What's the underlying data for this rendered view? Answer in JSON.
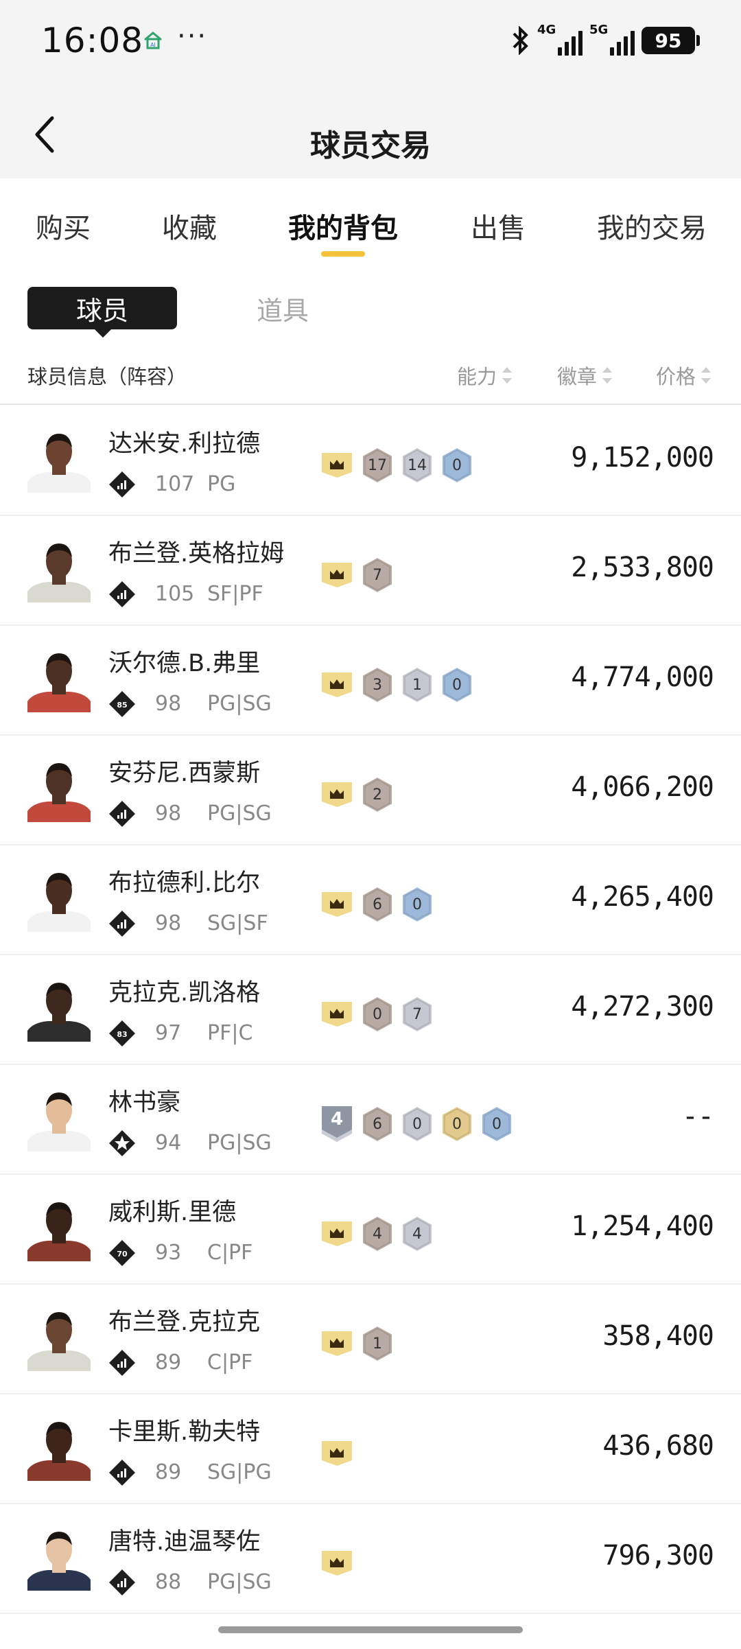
{
  "status_bar": {
    "time": "16:08",
    "dots": "···",
    "net_4g": "4G",
    "net_5g": "5G",
    "battery": "95"
  },
  "header": {
    "title": "球员交易",
    "back_icon": "chevron-left-icon"
  },
  "tabs": [
    {
      "label": "购买"
    },
    {
      "label": "收藏"
    },
    {
      "label": "我的背包",
      "active": true
    },
    {
      "label": "出售"
    },
    {
      "label": "我的交易"
    }
  ],
  "subtabs": {
    "active": "球员",
    "other": "道具"
  },
  "list_header": {
    "info": "球员信息（阵容）",
    "ability": "能力",
    "badge": "徽章",
    "price": "价格"
  },
  "colors": {
    "accent": "#f5c23b",
    "crown": "#f0d98a",
    "bronze": "#b7aba3",
    "silver": "#c6c7d0",
    "gold": "#e2c98c",
    "blue": "#9db9da"
  },
  "players": [
    {
      "name": "达米安.利拉德",
      "rating": "107",
      "position": "PG",
      "rank_icon": "signal-rank-icon",
      "rank_text": "",
      "crown": true,
      "badges": [
        {
          "type": "bronze",
          "count": "17"
        },
        {
          "type": "silver",
          "count": "14"
        },
        {
          "type": "blue",
          "count": "0"
        }
      ],
      "price": "9,152,000",
      "skin": "#6b4330",
      "jersey": "#f2f2f2"
    },
    {
      "name": "布兰登.英格拉姆",
      "rating": "105",
      "position": "SF|PF",
      "rank_icon": "signal-rank-icon",
      "rank_text": "",
      "crown": true,
      "badges": [
        {
          "type": "bronze",
          "count": "7"
        }
      ],
      "price": "2,533,800",
      "skin": "#5a3a2a",
      "jersey": "#d9d9d0"
    },
    {
      "name": "沃尔德.B.弗里",
      "rating": "98",
      "position": "PG|SG",
      "rank_icon": "number-rank-icon",
      "rank_text": "85",
      "crown": true,
      "badges": [
        {
          "type": "bronze",
          "count": "3"
        },
        {
          "type": "silver",
          "count": "1"
        },
        {
          "type": "blue",
          "count": "0"
        }
      ],
      "price": "4,774,000",
      "skin": "#4a2f22",
      "jersey": "#c24a3c"
    },
    {
      "name": "安芬尼.西蒙斯",
      "rating": "98",
      "position": "PG|SG",
      "rank_icon": "signal-rank-icon",
      "rank_text": "",
      "crown": true,
      "badges": [
        {
          "type": "bronze",
          "count": "2"
        }
      ],
      "price": "4,066,200",
      "skin": "#4e3225",
      "jersey": "#c24a3c"
    },
    {
      "name": "布拉德利.比尔",
      "rating": "98",
      "position": "SG|SF",
      "rank_icon": "signal-rank-icon",
      "rank_text": "",
      "crown": true,
      "badges": [
        {
          "type": "bronze",
          "count": "6"
        },
        {
          "type": "blue",
          "count": "0"
        }
      ],
      "price": "4,265,400",
      "skin": "#4a2e22",
      "jersey": "#f2f2f2"
    },
    {
      "name": "克拉克.凯洛格",
      "rating": "97",
      "position": "PF|C",
      "rank_icon": "number-rank-icon",
      "rank_text": "83",
      "crown": true,
      "badges": [
        {
          "type": "bronze",
          "count": "0"
        },
        {
          "type": "silver",
          "count": "7"
        }
      ],
      "price": "4,272,300",
      "skin": "#3e281e",
      "jersey": "#2d2d2d"
    },
    {
      "name": "林书豪",
      "rating": "94",
      "position": "PG|SG",
      "rank_icon": "star-rank-icon",
      "rank_text": "",
      "crown": false,
      "level_badge": "4",
      "badges": [
        {
          "type": "bronze",
          "count": "6"
        },
        {
          "type": "silver",
          "count": "0"
        },
        {
          "type": "gold",
          "count": "0"
        },
        {
          "type": "blue",
          "count": "0"
        }
      ],
      "price": "--",
      "skin": "#e3bd9a",
      "jersey": "#f2f2f2"
    },
    {
      "name": "威利斯.里德",
      "rating": "93",
      "position": "C|PF",
      "rank_icon": "number-rank-icon",
      "rank_text": "70",
      "crown": true,
      "badges": [
        {
          "type": "bronze",
          "count": "4"
        },
        {
          "type": "silver",
          "count": "4"
        }
      ],
      "price": "1,254,400",
      "skin": "#3a241a",
      "jersey": "#8a3a2c"
    },
    {
      "name": "布兰登.克拉克",
      "rating": "89",
      "position": "C|PF",
      "rank_icon": "signal-rank-icon",
      "rank_text": "",
      "crown": true,
      "badges": [
        {
          "type": "bronze",
          "count": "1"
        }
      ],
      "price": "358,400",
      "skin": "#6a4532",
      "jersey": "#d9d9d0"
    },
    {
      "name": "卡里斯.勒夫特",
      "rating": "89",
      "position": "SG|PG",
      "rank_icon": "signal-rank-icon",
      "rank_text": "",
      "crown": true,
      "badges": [],
      "price": "436,680",
      "skin": "#3e2419",
      "jersey": "#8a3a2c"
    },
    {
      "name": "唐特.迪温琴佐",
      "rating": "88",
      "position": "PG|SG",
      "rank_icon": "signal-rank-icon",
      "rank_text": "",
      "crown": true,
      "badges": [],
      "price": "796,300",
      "skin": "#e6c3a4",
      "jersey": "#2a3550"
    }
  ]
}
